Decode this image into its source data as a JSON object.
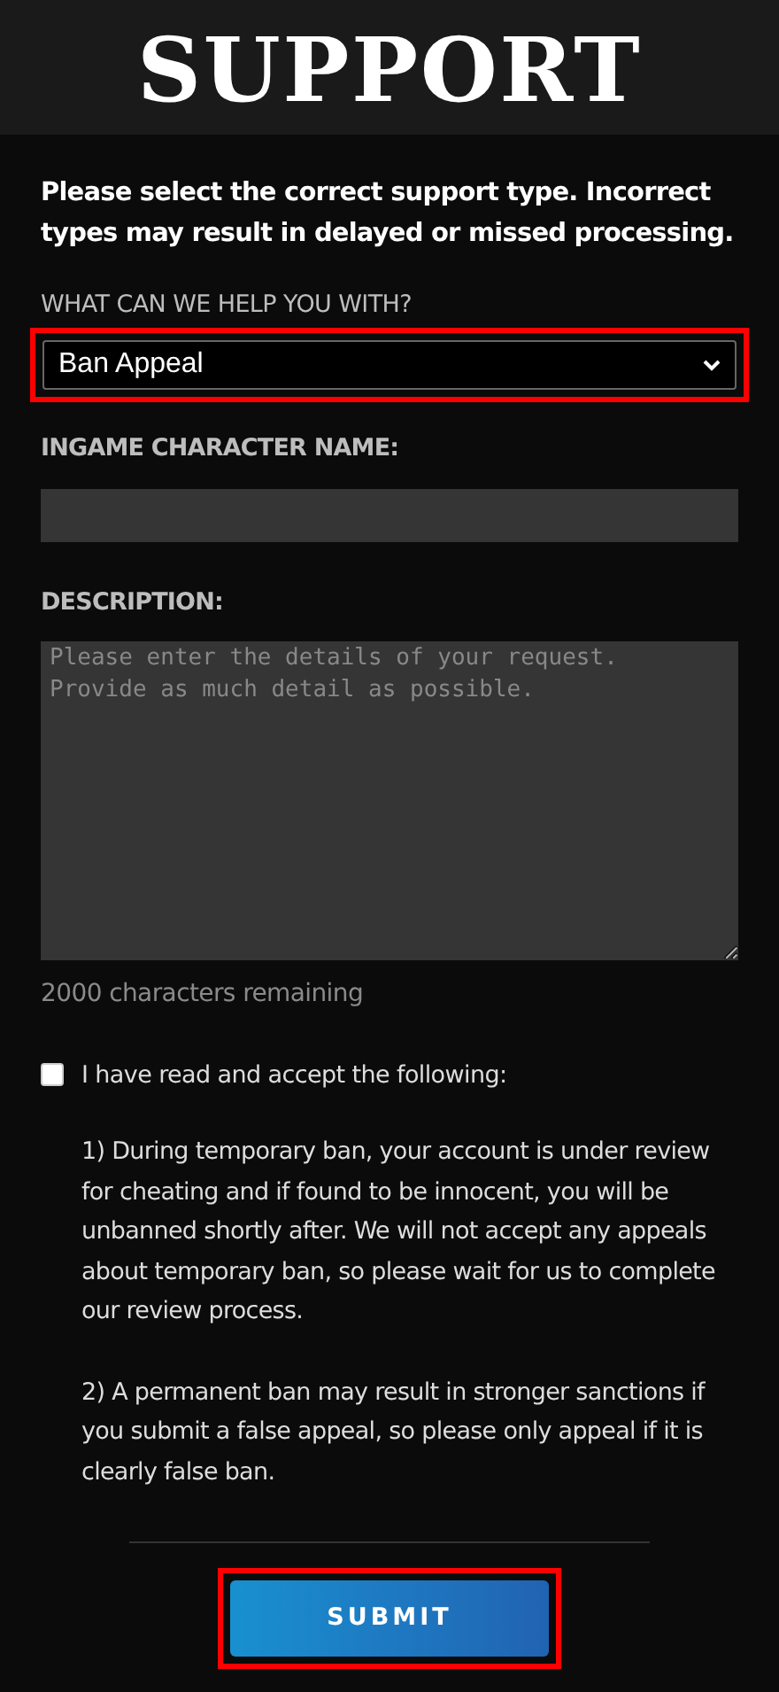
{
  "header": {
    "title": "SUPPORT"
  },
  "intro": "Please select the correct support type. Incorrect types may result in delayed or missed processing.",
  "support_type": {
    "label": "WHAT CAN WE HELP YOU WITH?",
    "value": "Ban Appeal",
    "highlighted": true
  },
  "character_name": {
    "label": "INGAME CHARACTER NAME:"
  },
  "description": {
    "label": "DESCRIPTION:",
    "placeholder": "Please enter the details of your request.\nProvide as much detail as possible.",
    "counter": "2000 characters remaining"
  },
  "agreement": {
    "label": "I have read and accept the following:",
    "checked": false,
    "terms": [
      "1) During temporary ban, your account is under review for cheating and if found to be innocent, you will be unbanned shortly after. We will not accept any appeals about temporary ban, so please wait for us to complete our review process.",
      "2) A permanent ban may result in stronger sanctions if you submit a false appeal, so please only appeal if it is clearly false ban."
    ]
  },
  "submit": {
    "label": "SUBMIT",
    "highlighted": true
  }
}
